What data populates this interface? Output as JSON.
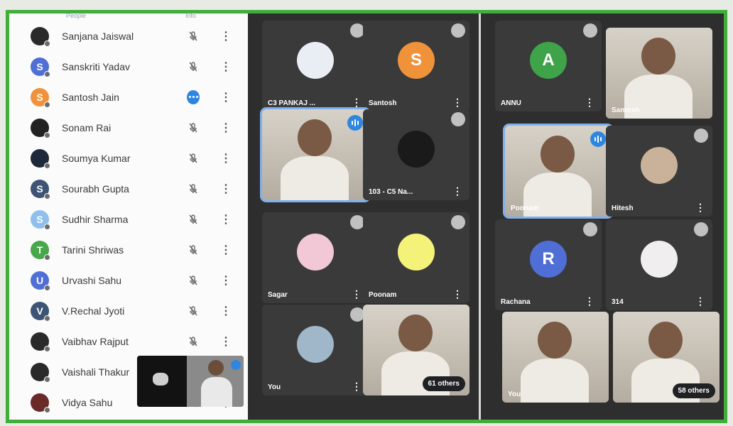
{
  "panel": {
    "header_people": "People",
    "header_info": "Info",
    "participants": [
      {
        "name": "Sanjana Jaiswal",
        "initial": "",
        "color": "#2a2a2a",
        "status": "muted"
      },
      {
        "name": "Sanskriti Yadav",
        "initial": "S",
        "color": "#4f6fd6",
        "status": "muted"
      },
      {
        "name": "Santosh Jain",
        "initial": "S",
        "color": "#f0923a",
        "status": "speaking"
      },
      {
        "name": "Sonam Rai",
        "initial": "",
        "color": "#222222",
        "status": "muted"
      },
      {
        "name": "Soumya Kumar",
        "initial": "",
        "color": "#1e2a3a",
        "status": "muted"
      },
      {
        "name": "Sourabh Gupta",
        "initial": "S",
        "color": "#3d5475",
        "status": "muted"
      },
      {
        "name": "Sudhir Sharma",
        "initial": "S",
        "color": "#8fc0ec",
        "status": "muted"
      },
      {
        "name": "Tarini Shriwas",
        "initial": "T",
        "color": "#46a84a",
        "status": "muted"
      },
      {
        "name": "Urvashi Sahu",
        "initial": "U",
        "color": "#4f6fd6",
        "status": "muted"
      },
      {
        "name": "V.Rechal Jyoti",
        "initial": "V",
        "color": "#3d5475",
        "status": "muted"
      },
      {
        "name": "Vaibhav Rajput",
        "initial": "",
        "color": "#2a2a2a",
        "status": "muted"
      },
      {
        "name": "Vaishali Thakur",
        "initial": "",
        "color": "#2a2a2a",
        "status": "muted"
      },
      {
        "name": "Vidya Sahu",
        "initial": "",
        "color": "#6a2a2a",
        "status": "muted"
      }
    ]
  },
  "grid_a": [
    {
      "name": "C3 PANKAJ ...",
      "kind": "photo",
      "color": "#e9eef5"
    },
    {
      "name": "Santosh",
      "kind": "initial",
      "initial": "S",
      "color": "#f0923a"
    },
    {
      "name": "",
      "kind": "video",
      "speaking": true
    },
    {
      "name": "103 - C5 Na...",
      "kind": "photo",
      "color": "#1a1a1a"
    },
    {
      "name": "Sagar",
      "kind": "photo",
      "color": "#f2c7d6"
    },
    {
      "name": "Poonam",
      "kind": "photo",
      "color": "#f5f27a"
    },
    {
      "name": "You",
      "kind": "photo",
      "color": "#9fb7c9"
    },
    {
      "name": "",
      "kind": "video",
      "others": "61 others"
    }
  ],
  "grid_b": [
    {
      "name": "ANNU",
      "kind": "initial",
      "initial": "A",
      "color": "#3fa34a"
    },
    {
      "name": "Santosh",
      "kind": "video"
    },
    {
      "name": "Poonam",
      "kind": "video",
      "speaking": true
    },
    {
      "name": "Hitesh",
      "kind": "photo",
      "color": "#c9b19a"
    },
    {
      "name": "Rachana",
      "kind": "initial",
      "initial": "R",
      "color": "#4f6fd6"
    },
    {
      "name": "314",
      "kind": "photo",
      "color": "#f1eef0"
    },
    {
      "name": "You",
      "kind": "video"
    },
    {
      "name": "",
      "kind": "video",
      "others": "58 others"
    }
  ]
}
